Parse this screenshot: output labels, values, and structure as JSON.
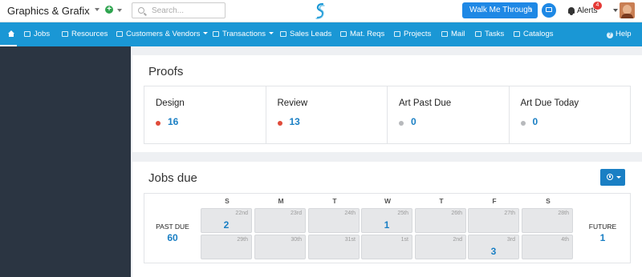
{
  "header": {
    "company_name": "Graphics & Grafix",
    "search_placeholder": "Search...",
    "walk_me_through_label": "Walk Me Through",
    "alerts_label": "Alerts",
    "alerts_count": "4"
  },
  "nav": {
    "items": [
      {
        "label": "Jobs",
        "icon": "gears-icon",
        "dropdown": false
      },
      {
        "label": "Resources",
        "icon": "resources-icon",
        "dropdown": false
      },
      {
        "label": "Customers & Vendors",
        "icon": "building-icon",
        "dropdown": true
      },
      {
        "label": "Transactions",
        "icon": "document-icon",
        "dropdown": true
      },
      {
        "label": "Sales Leads",
        "icon": "briefcase-icon",
        "dropdown": false
      },
      {
        "label": "Mat. Reqs",
        "icon": "list-icon",
        "dropdown": false
      },
      {
        "label": "Projects",
        "icon": "projects-icon",
        "dropdown": false
      },
      {
        "label": "Mail",
        "icon": "at-icon",
        "dropdown": false
      },
      {
        "label": "Tasks",
        "icon": "tasks-icon",
        "dropdown": false
      },
      {
        "label": "Catalogs",
        "icon": "catalog-icon",
        "dropdown": false
      }
    ],
    "help_label": "Help"
  },
  "proofs": {
    "title": "Proofs",
    "cards": [
      {
        "label": "Design",
        "count": "16",
        "status_color": "#e04b3a"
      },
      {
        "label": "Review",
        "count": "13",
        "status_color": "#e04b3a"
      },
      {
        "label": "Art Past Due",
        "count": "0",
        "status_color": "#b7b9bc"
      },
      {
        "label": "Art Due Today",
        "count": "0",
        "status_color": "#b7b9bc"
      }
    ]
  },
  "jobs_due": {
    "title": "Jobs due",
    "past_due_label": "PAST DUE",
    "past_due_count": "60",
    "future_label": "FUTURE",
    "future_count": "1",
    "weekdays": [
      "S",
      "M",
      "T",
      "W",
      "T",
      "F",
      "S"
    ],
    "weeks": [
      [
        {
          "date": "22nd",
          "count": "2"
        },
        {
          "date": "23rd",
          "count": ""
        },
        {
          "date": "24th",
          "count": ""
        },
        {
          "date": "25th",
          "count": "1"
        },
        {
          "date": "26th",
          "count": ""
        },
        {
          "date": "27th",
          "count": ""
        },
        {
          "date": "28th",
          "count": ""
        }
      ],
      [
        {
          "date": "29th",
          "count": ""
        },
        {
          "date": "30th",
          "count": ""
        },
        {
          "date": "31st",
          "count": ""
        },
        {
          "date": "1st",
          "count": ""
        },
        {
          "date": "2nd",
          "count": ""
        },
        {
          "date": "3rd",
          "count": "3"
        },
        {
          "date": "4th",
          "count": ""
        }
      ]
    ]
  },
  "colors": {
    "brand_blue": "#1a97d5",
    "link_blue": "#1a7fc4",
    "sidebar": "#2b3542"
  }
}
